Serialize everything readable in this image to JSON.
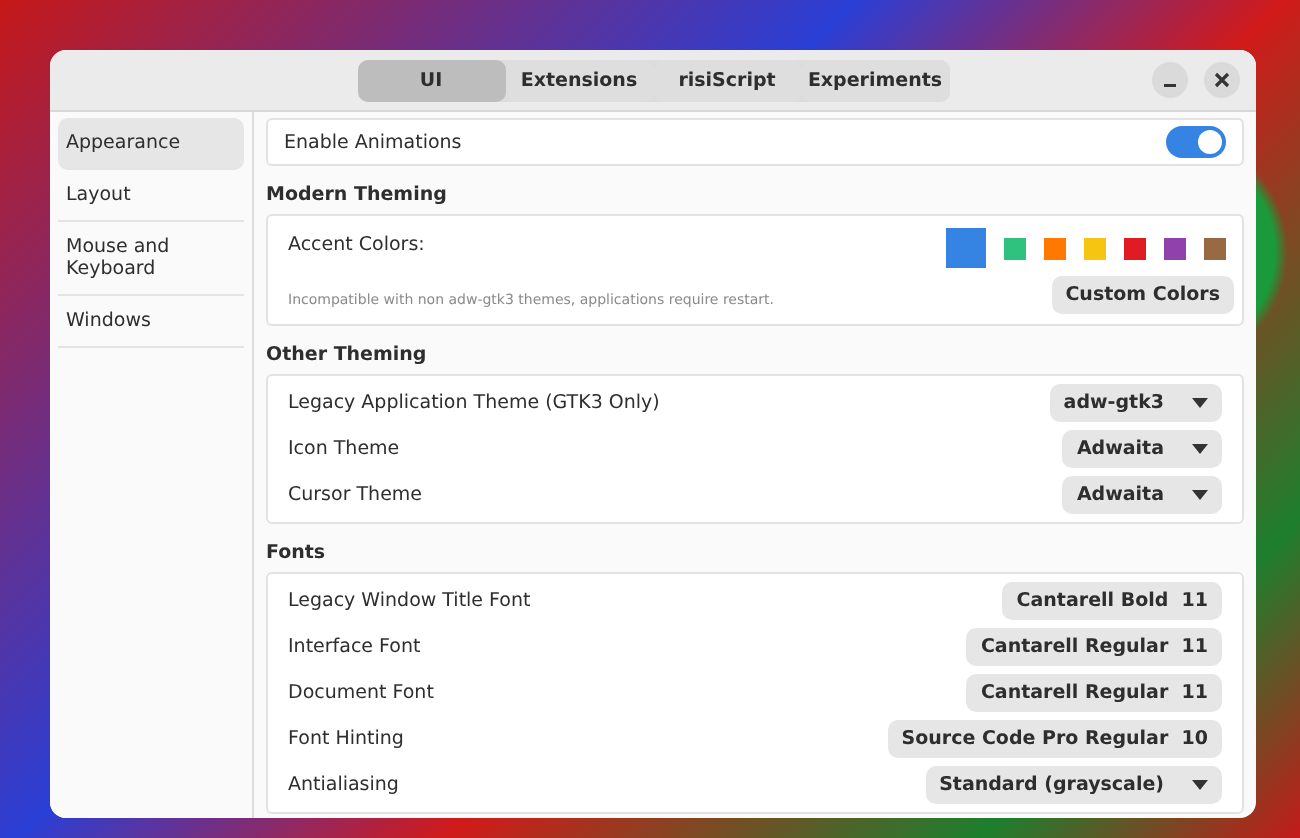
{
  "tabs": [
    {
      "label": "UI",
      "selected": true
    },
    {
      "label": "Extensions",
      "selected": false
    },
    {
      "label": "risiScript",
      "selected": false
    },
    {
      "label": "Experiments",
      "selected": false
    }
  ],
  "sidebar": {
    "items": [
      {
        "label": "Appearance",
        "selected": true
      },
      {
        "label": "Layout",
        "selected": false
      },
      {
        "label": "Mouse and Keyboard",
        "selected": false
      },
      {
        "label": "Windows",
        "selected": false
      }
    ]
  },
  "enable_animations": {
    "label": "Enable Animations",
    "on": true
  },
  "modern_theming": {
    "heading": "Modern Theming",
    "accent_label": "Accent Colors:",
    "note": "Incompatible with non adw-gtk3 themes, applications require restart.",
    "accent_colors": [
      {
        "color": "#3584e4",
        "selected": true
      },
      {
        "color": "#2ec27e",
        "selected": false
      },
      {
        "color": "#ff7800",
        "selected": false
      },
      {
        "color": "#f6c511",
        "selected": false
      },
      {
        "color": "#e01b24",
        "selected": false
      },
      {
        "color": "#9141ac",
        "selected": false
      },
      {
        "color": "#986a44",
        "selected": false
      }
    ],
    "button": "Custom Colors"
  },
  "other_theming": {
    "heading": "Other Theming",
    "rows": [
      {
        "label": "Legacy Application Theme (GTK3 Only)",
        "value": "adw-gtk3"
      },
      {
        "label": "Icon Theme",
        "value": "Adwaita"
      },
      {
        "label": "Cursor Theme",
        "value": "Adwaita"
      }
    ]
  },
  "fonts": {
    "heading": "Fonts",
    "rows": [
      {
        "kind": "font",
        "label": "Legacy Window Title Font",
        "value": "Cantarell Bold",
        "size": "11"
      },
      {
        "kind": "font",
        "label": "Interface Font",
        "value": "Cantarell Regular",
        "size": "11"
      },
      {
        "kind": "font",
        "label": "Document Font",
        "value": "Cantarell Regular",
        "size": "11"
      },
      {
        "kind": "font",
        "label": "Font Hinting",
        "value": "Source Code Pro Regular",
        "size": "10"
      },
      {
        "kind": "dropdown",
        "label": "Antialiasing",
        "value": "Standard (grayscale)"
      }
    ]
  }
}
